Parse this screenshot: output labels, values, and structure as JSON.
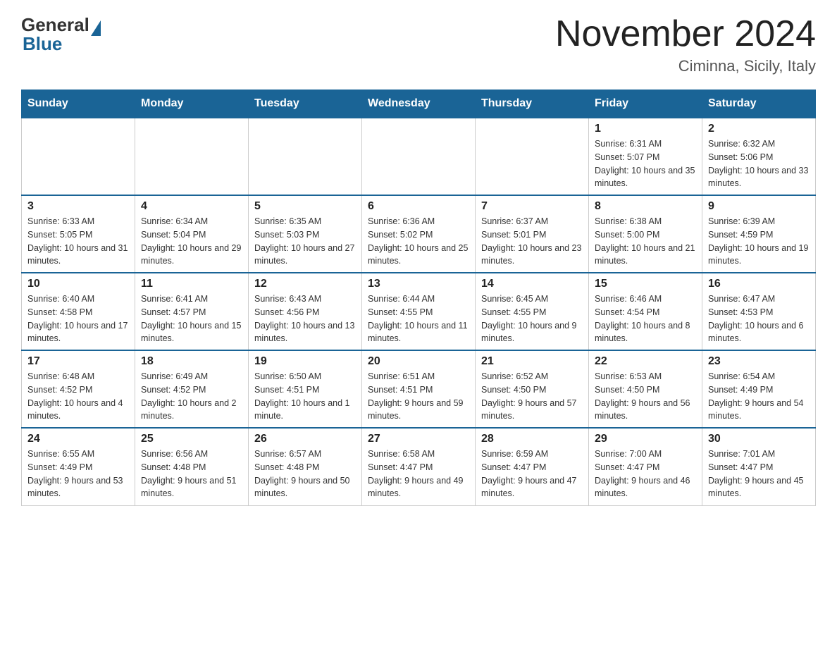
{
  "header": {
    "logo_general": "General",
    "logo_blue": "Blue",
    "month_title": "November 2024",
    "location": "Ciminna, Sicily, Italy"
  },
  "days_of_week": [
    "Sunday",
    "Monday",
    "Tuesday",
    "Wednesday",
    "Thursday",
    "Friday",
    "Saturday"
  ],
  "weeks": [
    [
      {
        "day": "",
        "info": ""
      },
      {
        "day": "",
        "info": ""
      },
      {
        "day": "",
        "info": ""
      },
      {
        "day": "",
        "info": ""
      },
      {
        "day": "",
        "info": ""
      },
      {
        "day": "1",
        "info": "Sunrise: 6:31 AM\nSunset: 5:07 PM\nDaylight: 10 hours and 35 minutes."
      },
      {
        "day": "2",
        "info": "Sunrise: 6:32 AM\nSunset: 5:06 PM\nDaylight: 10 hours and 33 minutes."
      }
    ],
    [
      {
        "day": "3",
        "info": "Sunrise: 6:33 AM\nSunset: 5:05 PM\nDaylight: 10 hours and 31 minutes."
      },
      {
        "day": "4",
        "info": "Sunrise: 6:34 AM\nSunset: 5:04 PM\nDaylight: 10 hours and 29 minutes."
      },
      {
        "day": "5",
        "info": "Sunrise: 6:35 AM\nSunset: 5:03 PM\nDaylight: 10 hours and 27 minutes."
      },
      {
        "day": "6",
        "info": "Sunrise: 6:36 AM\nSunset: 5:02 PM\nDaylight: 10 hours and 25 minutes."
      },
      {
        "day": "7",
        "info": "Sunrise: 6:37 AM\nSunset: 5:01 PM\nDaylight: 10 hours and 23 minutes."
      },
      {
        "day": "8",
        "info": "Sunrise: 6:38 AM\nSunset: 5:00 PM\nDaylight: 10 hours and 21 minutes."
      },
      {
        "day": "9",
        "info": "Sunrise: 6:39 AM\nSunset: 4:59 PM\nDaylight: 10 hours and 19 minutes."
      }
    ],
    [
      {
        "day": "10",
        "info": "Sunrise: 6:40 AM\nSunset: 4:58 PM\nDaylight: 10 hours and 17 minutes."
      },
      {
        "day": "11",
        "info": "Sunrise: 6:41 AM\nSunset: 4:57 PM\nDaylight: 10 hours and 15 minutes."
      },
      {
        "day": "12",
        "info": "Sunrise: 6:43 AM\nSunset: 4:56 PM\nDaylight: 10 hours and 13 minutes."
      },
      {
        "day": "13",
        "info": "Sunrise: 6:44 AM\nSunset: 4:55 PM\nDaylight: 10 hours and 11 minutes."
      },
      {
        "day": "14",
        "info": "Sunrise: 6:45 AM\nSunset: 4:55 PM\nDaylight: 10 hours and 9 minutes."
      },
      {
        "day": "15",
        "info": "Sunrise: 6:46 AM\nSunset: 4:54 PM\nDaylight: 10 hours and 8 minutes."
      },
      {
        "day": "16",
        "info": "Sunrise: 6:47 AM\nSunset: 4:53 PM\nDaylight: 10 hours and 6 minutes."
      }
    ],
    [
      {
        "day": "17",
        "info": "Sunrise: 6:48 AM\nSunset: 4:52 PM\nDaylight: 10 hours and 4 minutes."
      },
      {
        "day": "18",
        "info": "Sunrise: 6:49 AM\nSunset: 4:52 PM\nDaylight: 10 hours and 2 minutes."
      },
      {
        "day": "19",
        "info": "Sunrise: 6:50 AM\nSunset: 4:51 PM\nDaylight: 10 hours and 1 minute."
      },
      {
        "day": "20",
        "info": "Sunrise: 6:51 AM\nSunset: 4:51 PM\nDaylight: 9 hours and 59 minutes."
      },
      {
        "day": "21",
        "info": "Sunrise: 6:52 AM\nSunset: 4:50 PM\nDaylight: 9 hours and 57 minutes."
      },
      {
        "day": "22",
        "info": "Sunrise: 6:53 AM\nSunset: 4:50 PM\nDaylight: 9 hours and 56 minutes."
      },
      {
        "day": "23",
        "info": "Sunrise: 6:54 AM\nSunset: 4:49 PM\nDaylight: 9 hours and 54 minutes."
      }
    ],
    [
      {
        "day": "24",
        "info": "Sunrise: 6:55 AM\nSunset: 4:49 PM\nDaylight: 9 hours and 53 minutes."
      },
      {
        "day": "25",
        "info": "Sunrise: 6:56 AM\nSunset: 4:48 PM\nDaylight: 9 hours and 51 minutes."
      },
      {
        "day": "26",
        "info": "Sunrise: 6:57 AM\nSunset: 4:48 PM\nDaylight: 9 hours and 50 minutes."
      },
      {
        "day": "27",
        "info": "Sunrise: 6:58 AM\nSunset: 4:47 PM\nDaylight: 9 hours and 49 minutes."
      },
      {
        "day": "28",
        "info": "Sunrise: 6:59 AM\nSunset: 4:47 PM\nDaylight: 9 hours and 47 minutes."
      },
      {
        "day": "29",
        "info": "Sunrise: 7:00 AM\nSunset: 4:47 PM\nDaylight: 9 hours and 46 minutes."
      },
      {
        "day": "30",
        "info": "Sunrise: 7:01 AM\nSunset: 4:47 PM\nDaylight: 9 hours and 45 minutes."
      }
    ]
  ]
}
